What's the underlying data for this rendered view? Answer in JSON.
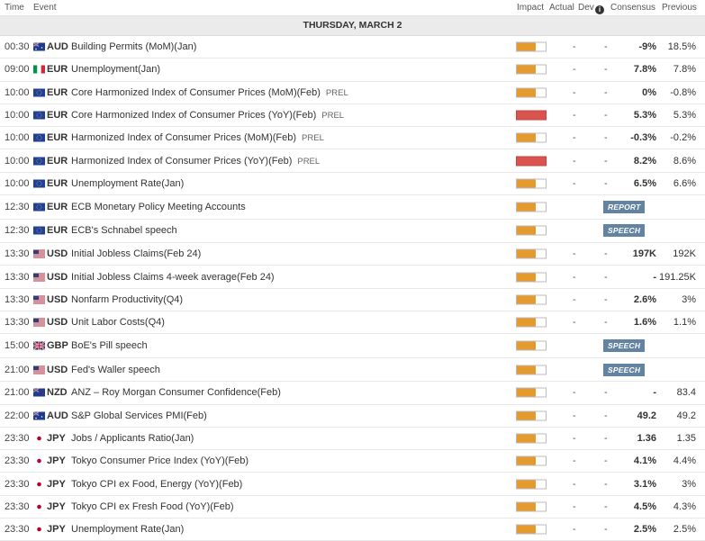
{
  "header": {
    "time": "Time",
    "event": "Event",
    "impact": "Impact",
    "actual": "Actual",
    "dev": "Dev",
    "consensus": "Consensus",
    "previous": "Previous"
  },
  "day_label": "THURSDAY, MARCH 2",
  "rows": [
    {
      "time": "00:30",
      "flag": "au-flag-icon",
      "currency": "AUD",
      "event": "Building Permits (MoM)(Jan)",
      "prel": "",
      "impact": "medium",
      "actual": "-",
      "dev": "-",
      "consensus": "-9%",
      "previous": "18.5%",
      "tag": ""
    },
    {
      "time": "09:00",
      "flag": "it-flag-icon",
      "currency": "EUR",
      "event": "Unemployment(Jan)",
      "prel": "",
      "impact": "medium",
      "actual": "-",
      "dev": "-",
      "consensus": "7.8%",
      "previous": "7.8%",
      "tag": ""
    },
    {
      "time": "10:00",
      "flag": "eu-flag-icon",
      "currency": "EUR",
      "event": "Core Harmonized Index of Consumer Prices (MoM)(Feb)",
      "prel": "PREL",
      "impact": "medium",
      "actual": "-",
      "dev": "-",
      "consensus": "0%",
      "previous": "-0.8%",
      "tag": ""
    },
    {
      "time": "10:00",
      "flag": "eu-flag-icon",
      "currency": "EUR",
      "event": "Core Harmonized Index of Consumer Prices (YoY)(Feb)",
      "prel": "PREL",
      "impact": "high",
      "actual": "-",
      "dev": "-",
      "consensus": "5.3%",
      "previous": "5.3%",
      "tag": ""
    },
    {
      "time": "10:00",
      "flag": "eu-flag-icon",
      "currency": "EUR",
      "event": "Harmonized Index of Consumer Prices (MoM)(Feb)",
      "prel": "PREL",
      "impact": "medium",
      "actual": "-",
      "dev": "-",
      "consensus": "-0.3%",
      "previous": "-0.2%",
      "tag": ""
    },
    {
      "time": "10:00",
      "flag": "eu-flag-icon",
      "currency": "EUR",
      "event": "Harmonized Index of Consumer Prices (YoY)(Feb)",
      "prel": "PREL",
      "impact": "high",
      "actual": "-",
      "dev": "-",
      "consensus": "8.2%",
      "previous": "8.6%",
      "tag": ""
    },
    {
      "time": "10:00",
      "flag": "eu-flag-icon",
      "currency": "EUR",
      "event": "Unemployment Rate(Jan)",
      "prel": "",
      "impact": "medium",
      "actual": "-",
      "dev": "-",
      "consensus": "6.5%",
      "previous": "6.6%",
      "tag": ""
    },
    {
      "time": "12:30",
      "flag": "eu-flag-icon",
      "currency": "EUR",
      "event": "ECB Monetary Policy Meeting Accounts",
      "prel": "",
      "impact": "medium",
      "actual": "",
      "dev": "",
      "consensus": "",
      "previous": "",
      "tag": "REPORT"
    },
    {
      "time": "12:30",
      "flag": "eu-flag-icon",
      "currency": "EUR",
      "event": "ECB's Schnabel speech",
      "prel": "",
      "impact": "medium",
      "actual": "",
      "dev": "",
      "consensus": "",
      "previous": "",
      "tag": "SPEECH"
    },
    {
      "time": "13:30",
      "flag": "us-flag-icon",
      "currency": "USD",
      "event": "Initial Jobless Claims(Feb 24)",
      "prel": "",
      "impact": "medium",
      "actual": "-",
      "dev": "-",
      "consensus": "197K",
      "previous": "192K",
      "tag": ""
    },
    {
      "time": "13:30",
      "flag": "us-flag-icon",
      "currency": "USD",
      "event": "Initial Jobless Claims 4-week average(Feb 24)",
      "prel": "",
      "impact": "medium",
      "actual": "-",
      "dev": "-",
      "consensus": "-",
      "previous": "191.25K",
      "tag": ""
    },
    {
      "time": "13:30",
      "flag": "us-flag-icon",
      "currency": "USD",
      "event": "Nonfarm Productivity(Q4)",
      "prel": "",
      "impact": "medium",
      "actual": "-",
      "dev": "-",
      "consensus": "2.6%",
      "previous": "3%",
      "tag": ""
    },
    {
      "time": "13:30",
      "flag": "us-flag-icon",
      "currency": "USD",
      "event": "Unit Labor Costs(Q4)",
      "prel": "",
      "impact": "medium",
      "actual": "-",
      "dev": "-",
      "consensus": "1.6%",
      "previous": "1.1%",
      "tag": ""
    },
    {
      "time": "15:00",
      "flag": "gb-flag-icon",
      "currency": "GBP",
      "event": "BoE's Pill speech",
      "prel": "",
      "impact": "medium",
      "actual": "",
      "dev": "",
      "consensus": "",
      "previous": "",
      "tag": "SPEECH"
    },
    {
      "time": "21:00",
      "flag": "us-flag-icon",
      "currency": "USD",
      "event": "Fed's Waller speech",
      "prel": "",
      "impact": "medium",
      "actual": "",
      "dev": "",
      "consensus": "",
      "previous": "",
      "tag": "SPEECH"
    },
    {
      "time": "21:00",
      "flag": "nz-flag-icon",
      "currency": "NZD",
      "event": "ANZ – Roy Morgan Consumer Confidence(Feb)",
      "prel": "",
      "impact": "medium",
      "actual": "-",
      "dev": "-",
      "consensus": "-",
      "previous": "83.4",
      "tag": ""
    },
    {
      "time": "22:00",
      "flag": "au-flag-icon",
      "currency": "AUD",
      "event": "S&P Global Services PMI(Feb)",
      "prel": "",
      "impact": "medium",
      "actual": "-",
      "dev": "-",
      "consensus": "49.2",
      "previous": "49.2",
      "tag": ""
    },
    {
      "time": "23:30",
      "flag": "jp-flag-icon",
      "currency": "JPY",
      "event": "Jobs / Applicants Ratio(Jan)",
      "prel": "",
      "impact": "medium",
      "actual": "-",
      "dev": "-",
      "consensus": "1.36",
      "previous": "1.35",
      "tag": ""
    },
    {
      "time": "23:30",
      "flag": "jp-flag-icon",
      "currency": "JPY",
      "event": "Tokyo Consumer Price Index (YoY)(Feb)",
      "prel": "",
      "impact": "medium",
      "actual": "-",
      "dev": "-",
      "consensus": "4.1%",
      "previous": "4.4%",
      "tag": ""
    },
    {
      "time": "23:30",
      "flag": "jp-flag-icon",
      "currency": "JPY",
      "event": "Tokyo CPI ex Food, Energy (YoY)(Feb)",
      "prel": "",
      "impact": "medium",
      "actual": "-",
      "dev": "-",
      "consensus": "3.1%",
      "previous": "3%",
      "tag": ""
    },
    {
      "time": "23:30",
      "flag": "jp-flag-icon",
      "currency": "JPY",
      "event": "Tokyo CPI ex Fresh Food (YoY)(Feb)",
      "prel": "",
      "impact": "medium",
      "actual": "-",
      "dev": "-",
      "consensus": "4.5%",
      "previous": "4.3%",
      "tag": ""
    },
    {
      "time": "23:30",
      "flag": "jp-flag-icon",
      "currency": "JPY",
      "event": "Unemployment Rate(Jan)",
      "prel": "",
      "impact": "medium",
      "actual": "-",
      "dev": "-",
      "consensus": "2.5%",
      "previous": "2.5%",
      "tag": ""
    }
  ],
  "colors": {
    "medium": "#e49a2c",
    "high": "#d9534f",
    "tag_bg": "#6383a3",
    "day_bg": "#ebebeb"
  }
}
